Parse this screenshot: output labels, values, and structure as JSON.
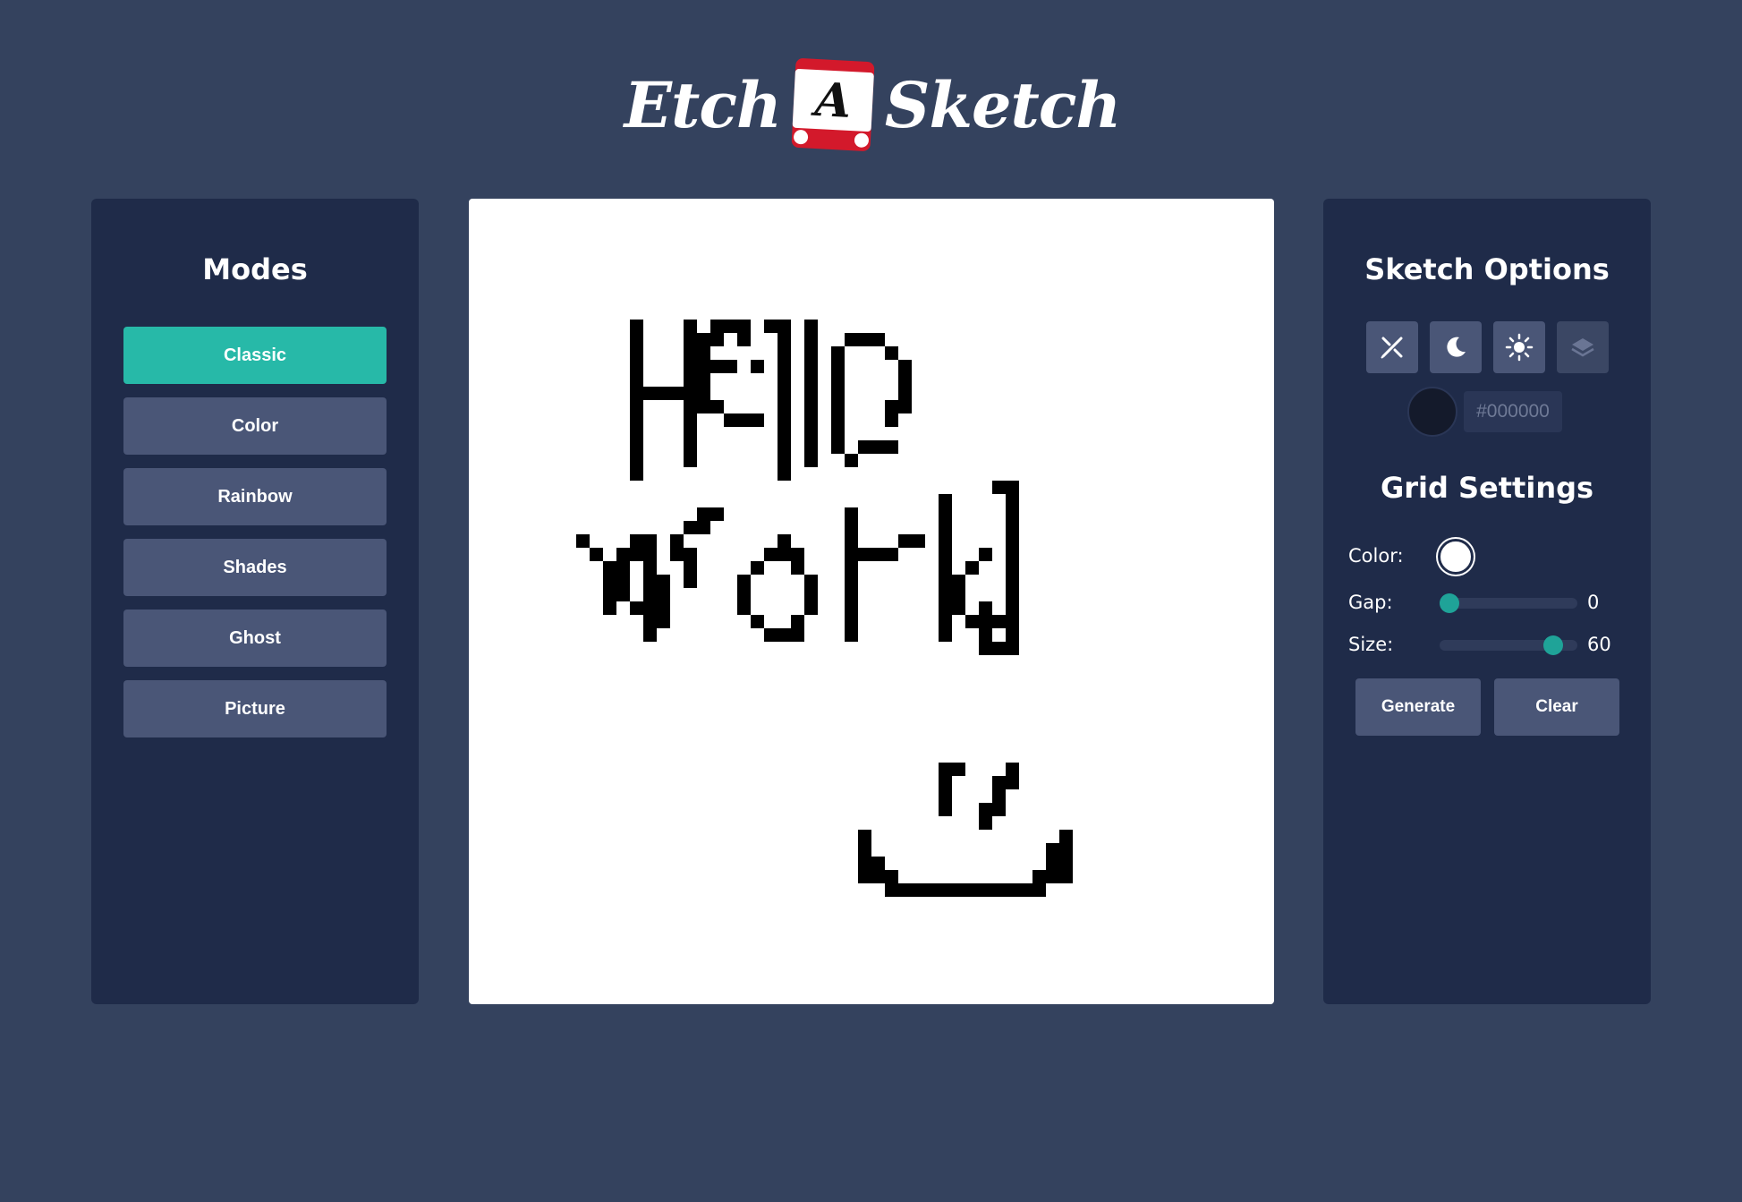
{
  "logo": {
    "word_left": "Etch",
    "badge_letter": "A",
    "word_right": "Sketch"
  },
  "modes": {
    "title": "Modes",
    "items": [
      {
        "label": "Classic",
        "active": true
      },
      {
        "label": "Color",
        "active": false
      },
      {
        "label": "Rainbow",
        "active": false
      },
      {
        "label": "Shades",
        "active": false
      },
      {
        "label": "Ghost",
        "active": false
      },
      {
        "label": "Picture",
        "active": false
      }
    ]
  },
  "sketch_options": {
    "title": "Sketch Options",
    "tools": [
      "pen-eraser-icon",
      "moon-icon",
      "sun-icon",
      "layers-icon"
    ],
    "pen_color": "#000000",
    "pen_color_label": "#000000"
  },
  "grid_settings": {
    "title": "Grid Settings",
    "color_label": "Color:",
    "grid_color": "#ffffff",
    "gap_label": "Gap:",
    "gap_value": "0",
    "gap_fraction": 0,
    "size_label": "Size:",
    "size_value": "60",
    "size_fraction": 0.88,
    "generate_label": "Generate",
    "clear_label": "Clear"
  },
  "canvas": {
    "grid_size": 60,
    "background": "#ffffff",
    "ink": "#000000",
    "drawing_description_cells": "pixel-art text Hello world and a smiley"
  },
  "colors": {
    "background": "#34425e",
    "panel": "#1f2b49",
    "accent": "#27b9a8",
    "button": "#4a5677"
  }
}
